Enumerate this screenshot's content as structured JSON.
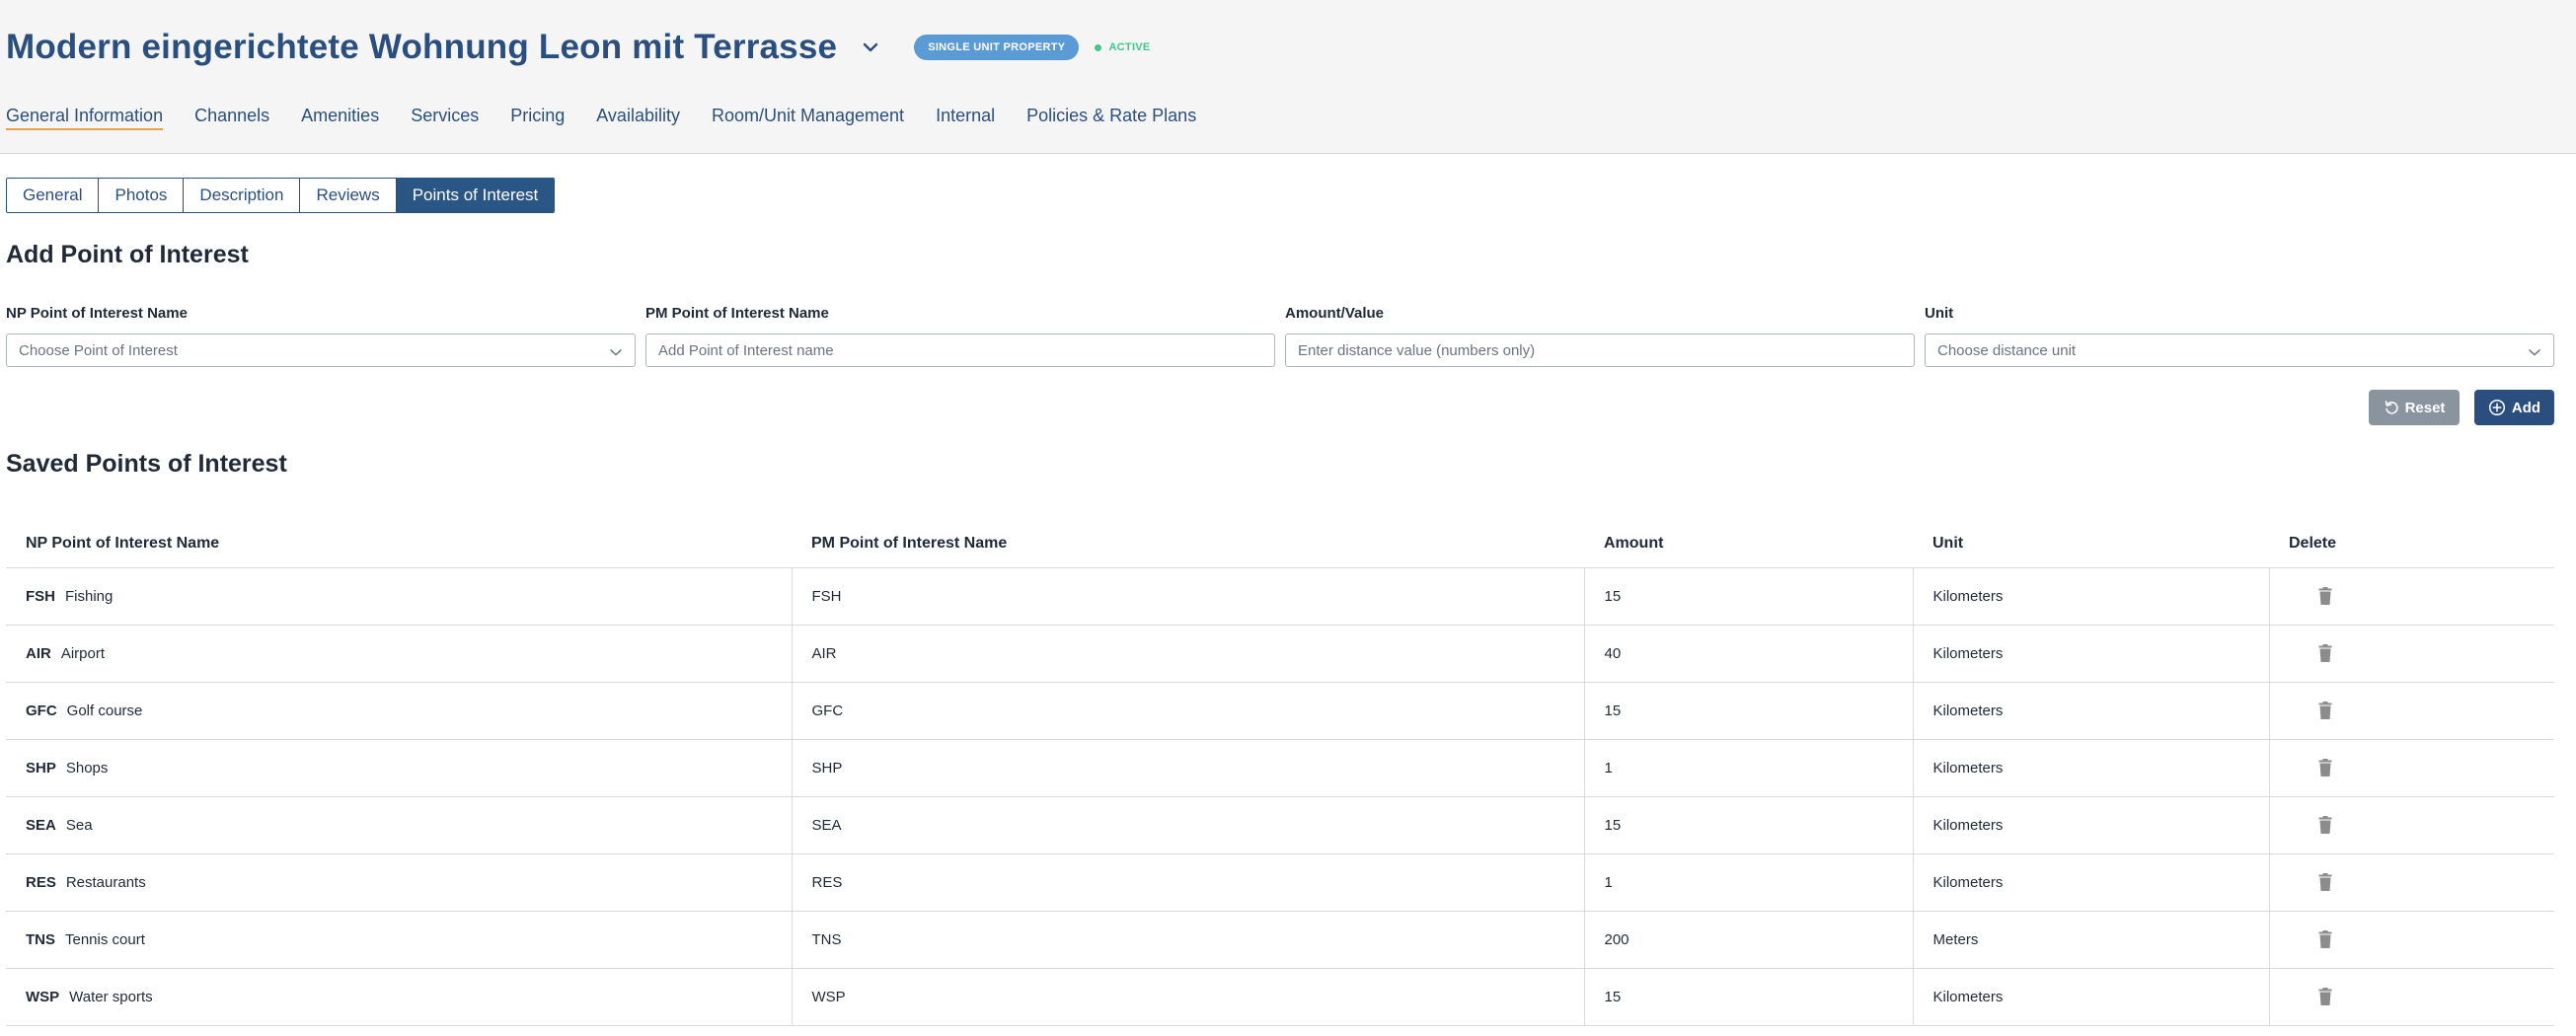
{
  "header": {
    "title": "Modern eingerichtete Wohnung Leon mit Terrasse",
    "badge": "SINGLE UNIT PROPERTY",
    "status": "ACTIVE"
  },
  "nav": {
    "items": [
      "General Information",
      "Channels",
      "Amenities",
      "Services",
      "Pricing",
      "Availability",
      "Room/Unit Management",
      "Internal",
      "Policies & Rate Plans"
    ],
    "active": "General Information"
  },
  "sub_tabs": {
    "items": [
      "General",
      "Photos",
      "Description",
      "Reviews",
      "Points of Interest"
    ],
    "active": "Points of Interest"
  },
  "add_section": {
    "title": "Add Point of Interest",
    "fields": [
      {
        "label": "NP Point of Interest Name",
        "placeholder": "Choose Point of Interest"
      },
      {
        "label": "PM Point of Interest Name",
        "placeholder": "Add Point of Interest name"
      },
      {
        "label": "Amount/Value",
        "placeholder": "Enter distance value (numbers only)"
      },
      {
        "label": "Unit",
        "placeholder": "Choose distance unit"
      }
    ],
    "reset_label": "Reset",
    "add_label": "Add"
  },
  "saved_section": {
    "title": "Saved Points of Interest",
    "columns": [
      "NP Point of Interest Name",
      "PM Point of Interest Name",
      "Amount",
      "Unit",
      "Delete"
    ],
    "rows": [
      {
        "code": "FSH",
        "name": "Fishing",
        "pm": "FSH",
        "amount": "15",
        "unit": "Kilometers"
      },
      {
        "code": "AIR",
        "name": "Airport",
        "pm": "AIR",
        "amount": "40",
        "unit": "Kilometers"
      },
      {
        "code": "GFC",
        "name": "Golf course",
        "pm": "GFC",
        "amount": "15",
        "unit": "Kilometers"
      },
      {
        "code": "SHP",
        "name": "Shops",
        "pm": "SHP",
        "amount": "1",
        "unit": "Kilometers"
      },
      {
        "code": "SEA",
        "name": "Sea",
        "pm": "SEA",
        "amount": "15",
        "unit": "Kilometers"
      },
      {
        "code": "RES",
        "name": "Restaurants",
        "pm": "RES",
        "amount": "1",
        "unit": "Kilometers"
      },
      {
        "code": "TNS",
        "name": "Tennis court",
        "pm": "TNS",
        "amount": "200",
        "unit": "Meters"
      },
      {
        "code": "WSP",
        "name": "Water sports",
        "pm": "WSP",
        "amount": "15",
        "unit": "Kilometers"
      }
    ]
  },
  "colors": {
    "primary": "#2a4f7f",
    "active_tab": "#2a5686",
    "badge": "#5b9bd5",
    "status_green": "#3cc98a",
    "nav_underline": "#e8a24a",
    "reset_button": "#8a949e"
  },
  "icons": {
    "title_chevron": "chevron-down-icon",
    "select_chevron": "chevron-down-icon",
    "reset": "rotate-ccw-icon",
    "add": "plus-circle-icon",
    "delete": "trash-icon"
  }
}
